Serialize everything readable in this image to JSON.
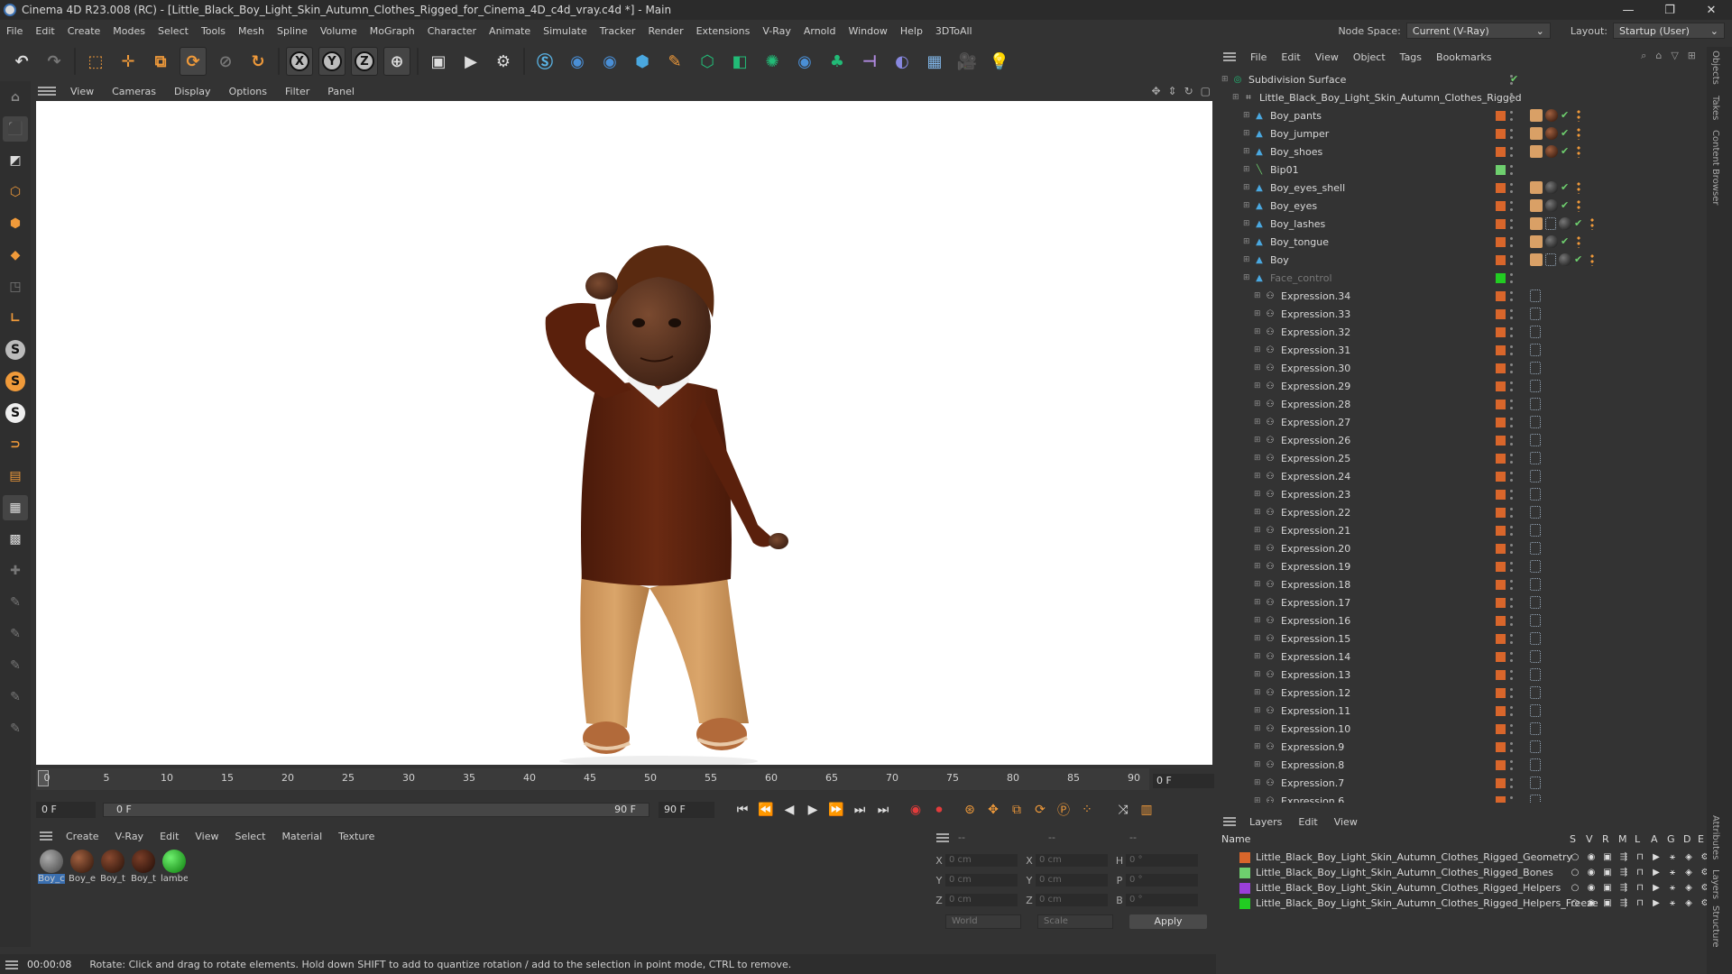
{
  "window": {
    "title": "Cinema 4D R23.008 (RC) - [Little_Black_Boy_Light_Skin_Autumn_Clothes_Rigged_for_Cinema_4D_c4d_vray.c4d *] - Main",
    "min": "—",
    "max": "❐",
    "close": "✕"
  },
  "menubar": {
    "items": [
      "File",
      "Edit",
      "Create",
      "Modes",
      "Select",
      "Tools",
      "Mesh",
      "Spline",
      "Volume",
      "MoGraph",
      "Character",
      "Animate",
      "Simulate",
      "Tracker",
      "Render",
      "Extensions",
      "V-Ray",
      "Arnold",
      "Window",
      "Help",
      "3DToAll"
    ],
    "node_space_label": "Node Space:",
    "node_space_value": "Current (V-Ray)",
    "layout_label": "Layout:",
    "layout_value": "Startup (User)"
  },
  "toolbar": {
    "axis_x": "X",
    "axis_y": "Y",
    "axis_z": "Z"
  },
  "viewport": {
    "menu": [
      "View",
      "Cameras",
      "Display",
      "Options",
      "Filter",
      "Panel"
    ]
  },
  "timeline": {
    "ticks": [
      "0",
      "5",
      "10",
      "15",
      "20",
      "25",
      "30",
      "35",
      "40",
      "45",
      "50",
      "55",
      "60",
      "65",
      "70",
      "75",
      "80",
      "85",
      "90"
    ],
    "current_frame": "0 F",
    "start_field": "0 F",
    "range_start": "0 F",
    "range_end": "90 F",
    "end_field": "90 F"
  },
  "material_manager": {
    "menu": [
      "Create",
      "V-Ray",
      "Edit",
      "View",
      "Select",
      "Material",
      "Texture"
    ],
    "materials": [
      {
        "name": "Boy_c",
        "color": "#6a6a6a"
      },
      {
        "name": "Boy_e",
        "color": "#5b2e1a"
      },
      {
        "name": "Boy_t",
        "color": "#4a2216"
      },
      {
        "name": "Boy_t",
        "color": "#3f1d12"
      },
      {
        "name": "lambe",
        "color": "#22cc22"
      }
    ]
  },
  "coordinates": {
    "header_a": "--",
    "header_b": "--",
    "header_c": "--",
    "rows": [
      {
        "a": "X",
        "av": "0 cm",
        "b": "X",
        "bv": "0 cm",
        "c": "H",
        "cv": "0 °"
      },
      {
        "a": "Y",
        "av": "0 cm",
        "b": "Y",
        "bv": "0 cm",
        "c": "P",
        "cv": "0 °"
      },
      {
        "a": "Z",
        "av": "0 cm",
        "b": "Z",
        "bv": "0 cm",
        "c": "B",
        "cv": "0 °"
      }
    ],
    "space": "World",
    "mode": "Scale",
    "apply": "Apply"
  },
  "statusbar": {
    "time": "00:00:08",
    "message": "Rotate: Click and drag to rotate elements. Hold down SHIFT to add to quantize rotation / add to the selection in point mode, CTRL to remove."
  },
  "object_manager": {
    "menu": [
      "File",
      "Edit",
      "View",
      "Object",
      "Tags",
      "Bookmarks"
    ],
    "objects": [
      {
        "name": "Subdivision Surface",
        "indent": 0,
        "icon": "subdivision-icon",
        "layer": "",
        "tags": "check"
      },
      {
        "name": "Little_Black_Boy_Light_Skin_Autumn_Clothes_Rigged",
        "indent": 1,
        "icon": "null-icon",
        "layer": "",
        "tags": ""
      },
      {
        "name": "Boy_pants",
        "indent": 2,
        "icon": "polygon-icon",
        "layer": "#d9662b",
        "tags": "face,mat-b,check,dots"
      },
      {
        "name": "Boy_jumper",
        "indent": 2,
        "icon": "polygon-icon",
        "layer": "#d9662b",
        "tags": "face,mat-b,check,dots"
      },
      {
        "name": "Boy_shoes",
        "indent": 2,
        "icon": "polygon-icon",
        "layer": "#d9662b",
        "tags": "face,mat-b,check,dots"
      },
      {
        "name": "Bip01",
        "indent": 2,
        "icon": "bone-icon",
        "layer": "#6ecf6e",
        "tags": ""
      },
      {
        "name": "Boy_eyes_shell",
        "indent": 2,
        "icon": "polygon-icon",
        "layer": "#d9662b",
        "tags": "face,mat-d,check,dots"
      },
      {
        "name": "Boy_eyes",
        "indent": 2,
        "icon": "polygon-icon",
        "layer": "#d9662b",
        "tags": "face,mat-d,check,dots"
      },
      {
        "name": "Boy_lashes",
        "indent": 2,
        "icon": "polygon-icon",
        "layer": "#d9662b",
        "tags": "face,xpr,mat-d,check,dots"
      },
      {
        "name": "Boy_tongue",
        "indent": 2,
        "icon": "polygon-icon",
        "layer": "#d9662b",
        "tags": "face,mat-d,check,dots"
      },
      {
        "name": "Boy",
        "indent": 2,
        "icon": "polygon-icon",
        "layer": "#d9662b",
        "tags": "face,xpr,mat-d,check,dots"
      },
      {
        "name": "Face_control",
        "indent": 2,
        "icon": "polygon-icon",
        "layer": "#22cc22",
        "tags": "",
        "dim": true
      },
      {
        "name": "Expression.34",
        "indent": 3,
        "icon": "expression-icon",
        "layer": "#d9662b",
        "tags": "xpr"
      },
      {
        "name": "Expression.33",
        "indent": 3,
        "icon": "expression-icon",
        "layer": "#d9662b",
        "tags": "xpr"
      },
      {
        "name": "Expression.32",
        "indent": 3,
        "icon": "expression-icon",
        "layer": "#d9662b",
        "tags": "xpr"
      },
      {
        "name": "Expression.31",
        "indent": 3,
        "icon": "expression-icon",
        "layer": "#d9662b",
        "tags": "xpr"
      },
      {
        "name": "Expression.30",
        "indent": 3,
        "icon": "expression-icon",
        "layer": "#d9662b",
        "tags": "xpr"
      },
      {
        "name": "Expression.29",
        "indent": 3,
        "icon": "expression-icon",
        "layer": "#d9662b",
        "tags": "xpr"
      },
      {
        "name": "Expression.28",
        "indent": 3,
        "icon": "expression-icon",
        "layer": "#d9662b",
        "tags": "xpr"
      },
      {
        "name": "Expression.27",
        "indent": 3,
        "icon": "expression-icon",
        "layer": "#d9662b",
        "tags": "xpr"
      },
      {
        "name": "Expression.26",
        "indent": 3,
        "icon": "expression-icon",
        "layer": "#d9662b",
        "tags": "xpr"
      },
      {
        "name": "Expression.25",
        "indent": 3,
        "icon": "expression-icon",
        "layer": "#d9662b",
        "tags": "xpr"
      },
      {
        "name": "Expression.24",
        "indent": 3,
        "icon": "expression-icon",
        "layer": "#d9662b",
        "tags": "xpr"
      },
      {
        "name": "Expression.23",
        "indent": 3,
        "icon": "expression-icon",
        "layer": "#d9662b",
        "tags": "xpr"
      },
      {
        "name": "Expression.22",
        "indent": 3,
        "icon": "expression-icon",
        "layer": "#d9662b",
        "tags": "xpr"
      },
      {
        "name": "Expression.21",
        "indent": 3,
        "icon": "expression-icon",
        "layer": "#d9662b",
        "tags": "xpr"
      },
      {
        "name": "Expression.20",
        "indent": 3,
        "icon": "expression-icon",
        "layer": "#d9662b",
        "tags": "xpr"
      },
      {
        "name": "Expression.19",
        "indent": 3,
        "icon": "expression-icon",
        "layer": "#d9662b",
        "tags": "xpr"
      },
      {
        "name": "Expression.18",
        "indent": 3,
        "icon": "expression-icon",
        "layer": "#d9662b",
        "tags": "xpr"
      },
      {
        "name": "Expression.17",
        "indent": 3,
        "icon": "expression-icon",
        "layer": "#d9662b",
        "tags": "xpr"
      },
      {
        "name": "Expression.16",
        "indent": 3,
        "icon": "expression-icon",
        "layer": "#d9662b",
        "tags": "xpr"
      },
      {
        "name": "Expression.15",
        "indent": 3,
        "icon": "expression-icon",
        "layer": "#d9662b",
        "tags": "xpr"
      },
      {
        "name": "Expression.14",
        "indent": 3,
        "icon": "expression-icon",
        "layer": "#d9662b",
        "tags": "xpr"
      },
      {
        "name": "Expression.13",
        "indent": 3,
        "icon": "expression-icon",
        "layer": "#d9662b",
        "tags": "xpr"
      },
      {
        "name": "Expression.12",
        "indent": 3,
        "icon": "expression-icon",
        "layer": "#d9662b",
        "tags": "xpr"
      },
      {
        "name": "Expression.11",
        "indent": 3,
        "icon": "expression-icon",
        "layer": "#d9662b",
        "tags": "xpr"
      },
      {
        "name": "Expression.10",
        "indent": 3,
        "icon": "expression-icon",
        "layer": "#d9662b",
        "tags": "xpr"
      },
      {
        "name": "Expression.9",
        "indent": 3,
        "icon": "expression-icon",
        "layer": "#d9662b",
        "tags": "xpr"
      },
      {
        "name": "Expression.8",
        "indent": 3,
        "icon": "expression-icon",
        "layer": "#d9662b",
        "tags": "xpr"
      },
      {
        "name": "Expression.7",
        "indent": 3,
        "icon": "expression-icon",
        "layer": "#d9662b",
        "tags": "xpr"
      },
      {
        "name": "Expression.6",
        "indent": 3,
        "icon": "expression-icon",
        "layer": "#d9662b",
        "tags": "xpr"
      }
    ]
  },
  "layer_manager": {
    "menu": [
      "Layers",
      "Edit",
      "View"
    ],
    "col_name": "Name",
    "flags": [
      "S",
      "V",
      "R",
      "M",
      "L",
      "A",
      "G",
      "D",
      "E"
    ],
    "layers": [
      {
        "name": "Little_Black_Boy_Light_Skin_Autumn_Clothes_Rigged_Geometry",
        "color": "#d9662b"
      },
      {
        "name": "Little_Black_Boy_Light_Skin_Autumn_Clothes_Rigged_Bones",
        "color": "#6ecf6e"
      },
      {
        "name": "Little_Black_Boy_Light_Skin_Autumn_Clothes_Rigged_Helpers",
        "color": "#9a3fd9"
      },
      {
        "name": "Little_Black_Boy_Light_Skin_Autumn_Clothes_Rigged_Helpers_Freeze",
        "color": "#22cc22"
      }
    ]
  },
  "side_tabs": [
    "Objects",
    "Takes",
    "Content Browser",
    "Attributes",
    "Layers",
    "Structure"
  ]
}
